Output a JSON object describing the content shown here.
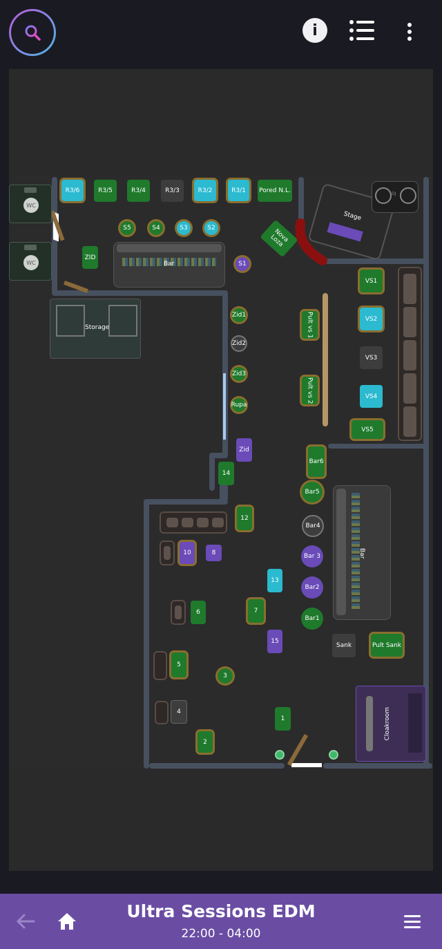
{
  "header": {
    "search_icon": "search-icon",
    "info_icon": "info-icon",
    "list_icon": "list-icon",
    "more_icon": "more-vertical-icon"
  },
  "venue": {
    "wc1": "WC",
    "wc2": "WC",
    "r_row": [
      "R3/6",
      "R3/5",
      "R3/4",
      "R3/3",
      "R3/2",
      "R3/1",
      "Pored N.L."
    ],
    "s_row": [
      "S5",
      "S4",
      "S3",
      "S2"
    ],
    "zid_left": "ZID",
    "top_bar": "Bar",
    "s1": "S1",
    "nova_loza": "Nova Loza",
    "stage": "Stage",
    "dj": "DJ",
    "storage": "Storage",
    "zid_col": [
      "Zid1",
      "Zid2",
      "Zid3",
      "Rupa"
    ],
    "zid_purple": "Zid",
    "pult1": "Pult vs 1",
    "pult2": "Pult vs 2",
    "vs": [
      "VS1",
      "VS2",
      "VS3",
      "VS4",
      "VS5"
    ],
    "bar6": "Bar6",
    "bar5": "Bar5",
    "bar4": "Bar4",
    "bar3": "Bar 3",
    "bar2": "Bar2",
    "bar1": "Bar1",
    "side_bar": "Bar",
    "t14": "14",
    "t12": "12",
    "t10": "10",
    "t8": "8",
    "t13": "13",
    "t7": "7",
    "t6": "6",
    "t15": "15",
    "t5": "5",
    "t3": "3",
    "t4": "4",
    "t1": "1",
    "t2": "2",
    "sank": "Sank",
    "pult_sank": "Pult Sank",
    "cloakroom": "Cloakroom"
  },
  "footer": {
    "title": "Ultra Sessions EDM",
    "time": "22:00 - 04:00",
    "back_icon": "back-arrow-icon",
    "home_icon": "home-icon",
    "menu_icon": "menu-icon"
  }
}
